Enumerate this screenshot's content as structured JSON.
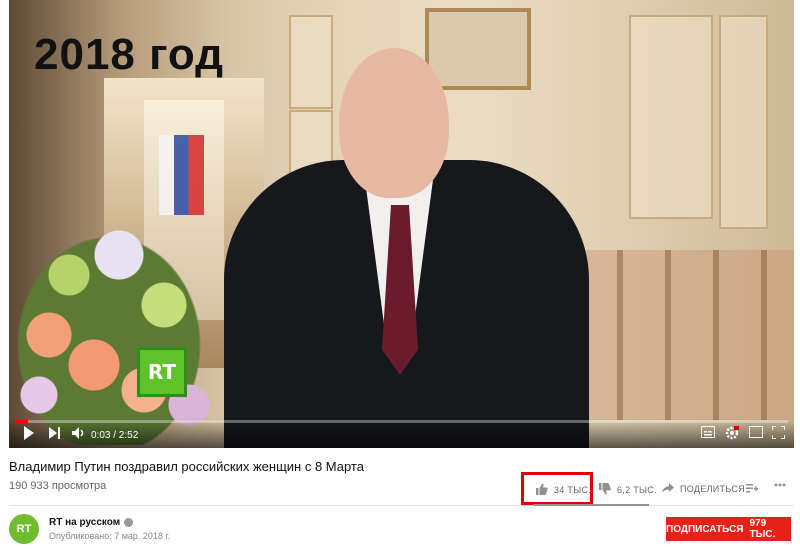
{
  "video": {
    "overlay_text": "2018 год",
    "watermark": "RT",
    "current_time": "0:03",
    "duration": "2:52",
    "time_display": "0:03 / 2:52",
    "progress": 0.017
  },
  "info": {
    "title": "Владимир Путин поздравил российских женщин с 8 Марта",
    "views": "190 933 просмотра",
    "likes": "34 ТЫС.",
    "dislikes": "6,2 ТЫС.",
    "share_label": "ПОДЕЛИТЬСЯ"
  },
  "channel": {
    "avatar_text": "RT",
    "name": "RT на русском",
    "published": "Опубликовано: 7 мар. 2018 г.",
    "subscribe_label": "ПОДПИСАТЬСЯ",
    "subscriber_count": "979 ТЫС."
  },
  "colors": {
    "subscribe": "#e62117",
    "highlight": "#e30000",
    "progress": "#ff0000",
    "rt_green": "#5fc22a"
  },
  "icons": [
    "play-icon",
    "next-icon",
    "volume-icon",
    "subtitles-icon",
    "settings-icon",
    "miniplayer-icon",
    "fullscreen-icon",
    "thumbs-up-icon",
    "thumbs-down-icon",
    "share-icon",
    "add-to-playlist-icon",
    "more-icon",
    "verified-icon"
  ]
}
